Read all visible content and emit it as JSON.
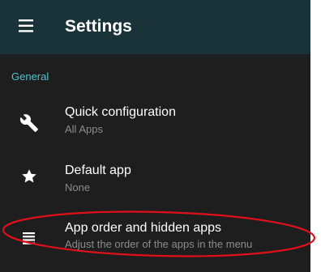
{
  "app_bar": {
    "title": "Settings",
    "menu_icon": "hamburger-menu-icon",
    "background": "#193338"
  },
  "section": {
    "header": "General",
    "header_color": "#4cc3cf"
  },
  "items": [
    {
      "icon": "wrench-icon",
      "title": "Quick configuration",
      "subtitle": "All Apps"
    },
    {
      "icon": "star-icon",
      "title": "Default app",
      "subtitle": "None"
    },
    {
      "icon": "list-icon",
      "title": "App order and hidden apps",
      "subtitle": "Adjust the order of the apps in the menu"
    }
  ],
  "annotation": {
    "shape": "ellipse",
    "color": "#e0101a",
    "highlights": "App order and hidden apps"
  }
}
